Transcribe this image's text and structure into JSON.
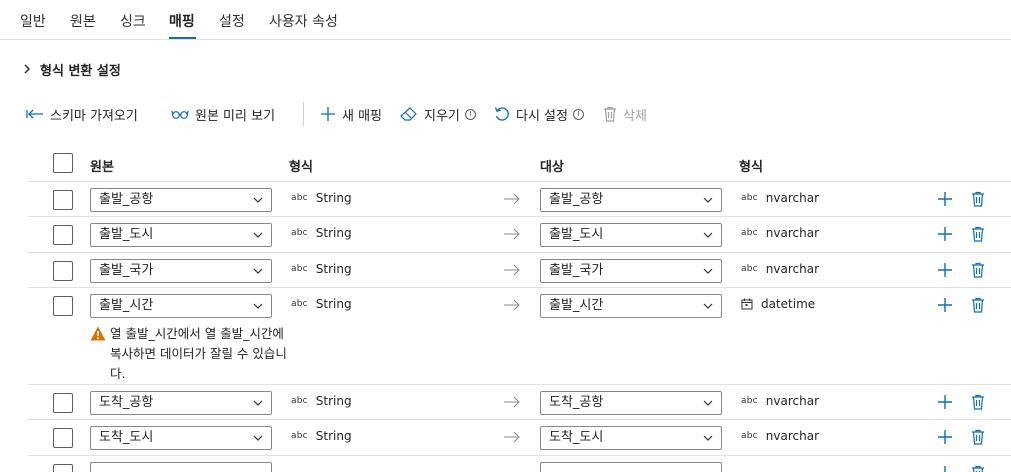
{
  "tabs": [
    {
      "label": "일반"
    },
    {
      "label": "원본"
    },
    {
      "label": "싱크"
    },
    {
      "label": "매핑"
    },
    {
      "label": "설정"
    },
    {
      "label": "사용자 속성"
    }
  ],
  "active_tab": "매핑",
  "section": {
    "title": "형식 변환 설정",
    "chevron": "chevron-right-icon"
  },
  "toolbar": {
    "import_schema": "스키마 가져오기",
    "preview_source": "원본 미리 보기",
    "new_mapping": "새 매핑",
    "clear": "지우기",
    "reset": "다시 설정",
    "delete": "삭제"
  },
  "table": {
    "headers": {
      "source": "원본",
      "source_type": "형식",
      "target": "대상",
      "target_type": "형식"
    },
    "rows": [
      {
        "source": "출발_공항",
        "source_type": "String",
        "source_type_icon": "abc",
        "target": "출발_공항",
        "target_type": "nvarchar",
        "target_type_icon": "abc"
      },
      {
        "source": "출발_도시",
        "source_type": "String",
        "source_type_icon": "abc",
        "target": "출발_도시",
        "target_type": "nvarchar",
        "target_type_icon": "abc"
      },
      {
        "source": "출발_국가",
        "source_type": "String",
        "source_type_icon": "abc",
        "target": "출발_국가",
        "target_type": "nvarchar",
        "target_type_icon": "abc"
      },
      {
        "source": "출발_시간",
        "source_type": "String",
        "source_type_icon": "abc",
        "target": "출발_시간",
        "target_type": "datetime",
        "target_type_icon": "calendar-icon",
        "warning": "열 출발_시간에서 열 출발_시간에 복사하면 데이터가 잘릴 수 있습니다."
      },
      {
        "source": "도착_공항",
        "source_type": "String",
        "source_type_icon": "abc",
        "target": "도착_공항",
        "target_type": "nvarchar",
        "target_type_icon": "abc"
      },
      {
        "source": "도착_도시",
        "source_type": "String",
        "source_type_icon": "abc",
        "target": "도착_도시",
        "target_type": "nvarchar",
        "target_type_icon": "abc"
      }
    ]
  },
  "colors": {
    "accent": "#0f6cbd",
    "warning": "#d47500",
    "border": "#8a8886",
    "divider": "#e1e1e1"
  }
}
